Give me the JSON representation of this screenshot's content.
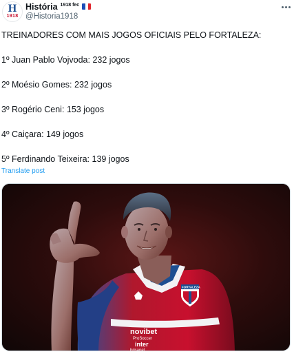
{
  "post": {
    "author": {
      "display_name": "História",
      "name_suffix": "1918 fec",
      "handle": "@Historia1918",
      "avatar_letter": "H",
      "avatar_year": "1918",
      "flag": "france-flag-icon"
    },
    "more_icon": "more-options-icon",
    "lines": [
      "TREINADORES COM MAIS JOGOS OFICIAIS PELO FORTALEZA:",
      "1º Juan Pablo Vojvoda: 232 jogos",
      "2º Moésio Gomes: 232 jogos",
      "3º Rogério Ceni: 153 jogos",
      "4º Caiçara: 149 jogos",
      "5º Ferdinando Teixeira: 139 jogos"
    ],
    "translate_label": "Translate post",
    "media": {
      "shirt_sponsor_lines": [
        "novibet",
        "ProSoccer",
        "inter",
        "brisanet"
      ],
      "crest_label": "FORTALEZA"
    }
  },
  "colors": {
    "text": "#0f1419",
    "secondary": "#536471",
    "link": "#1d9bf0",
    "shirt_red": "#c8102e",
    "shirt_blue": "#1d4f91"
  }
}
